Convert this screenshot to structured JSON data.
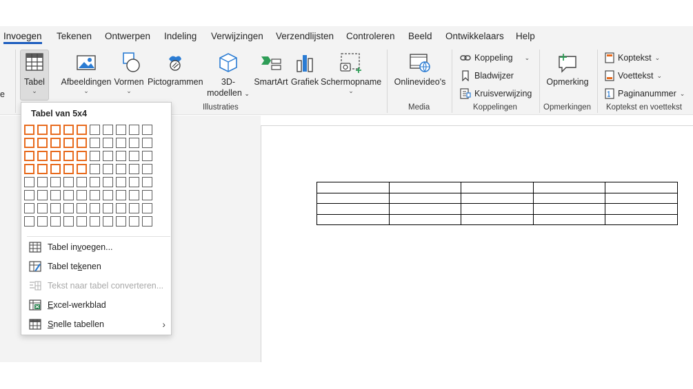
{
  "tabs": [
    {
      "label": "Invoegen",
      "active": true
    },
    {
      "label": "Tekenen"
    },
    {
      "label": "Ontwerpen"
    },
    {
      "label": "Indeling"
    },
    {
      "label": "Verwijzingen"
    },
    {
      "label": "Verzendlijsten"
    },
    {
      "label": "Controleren"
    },
    {
      "label": "Beeld"
    },
    {
      "label": "Ontwikkelaars"
    },
    {
      "label": "Help"
    }
  ],
  "ribbon": {
    "left_fragment": "e",
    "tabel": "Tabel",
    "afbeeldingen": "Afbeeldingen",
    "vormen": "Vormen",
    "pictogrammen": "Pictogrammen",
    "modellen_line1": "3D-",
    "modellen_line2": "modellen",
    "smartart": "SmartArt",
    "grafiek": "Grafiek",
    "schermopname": "Schermopname",
    "onlinevideos": "Onlinevideo's",
    "koppeling": "Koppeling",
    "bladwijzer": "Bladwijzer",
    "kruisverwijzing": "Kruisverwijzing",
    "opmerking": "Opmerking",
    "koptekst": "Koptekst",
    "voettekst": "Voettekst",
    "paginanummer": "Paginanummer",
    "groups": {
      "illustraties": "Illustraties",
      "media": "Media",
      "koppelingen": "Koppelingen",
      "opmerkingen": "Opmerkingen",
      "koptekst_voettekst": "Koptekst en voettekst"
    },
    "chevron": "⌄"
  },
  "dropdown": {
    "title": "Tabel van 5x4",
    "grid": {
      "columns": 10,
      "rows": 8,
      "selected_columns": 5,
      "selected_rows": 4
    },
    "items": {
      "tabel_invoegen": {
        "pre": "Tabel in",
        "key": "v",
        "post": "oegen..."
      },
      "tabel_tekenen": {
        "pre": "Tabel te",
        "key": "k",
        "post": "enen"
      },
      "tekst_converteren": "Tekst naar tabel converteren...",
      "excel": {
        "pre": "",
        "key": "E",
        "post": "xcel-werkblad"
      },
      "snelle": {
        "pre": "",
        "key": "S",
        "post": "nelle tabellen"
      }
    },
    "submenu_arrow": "›"
  },
  "document": {
    "table_rows": 4,
    "table_columns": 5
  }
}
